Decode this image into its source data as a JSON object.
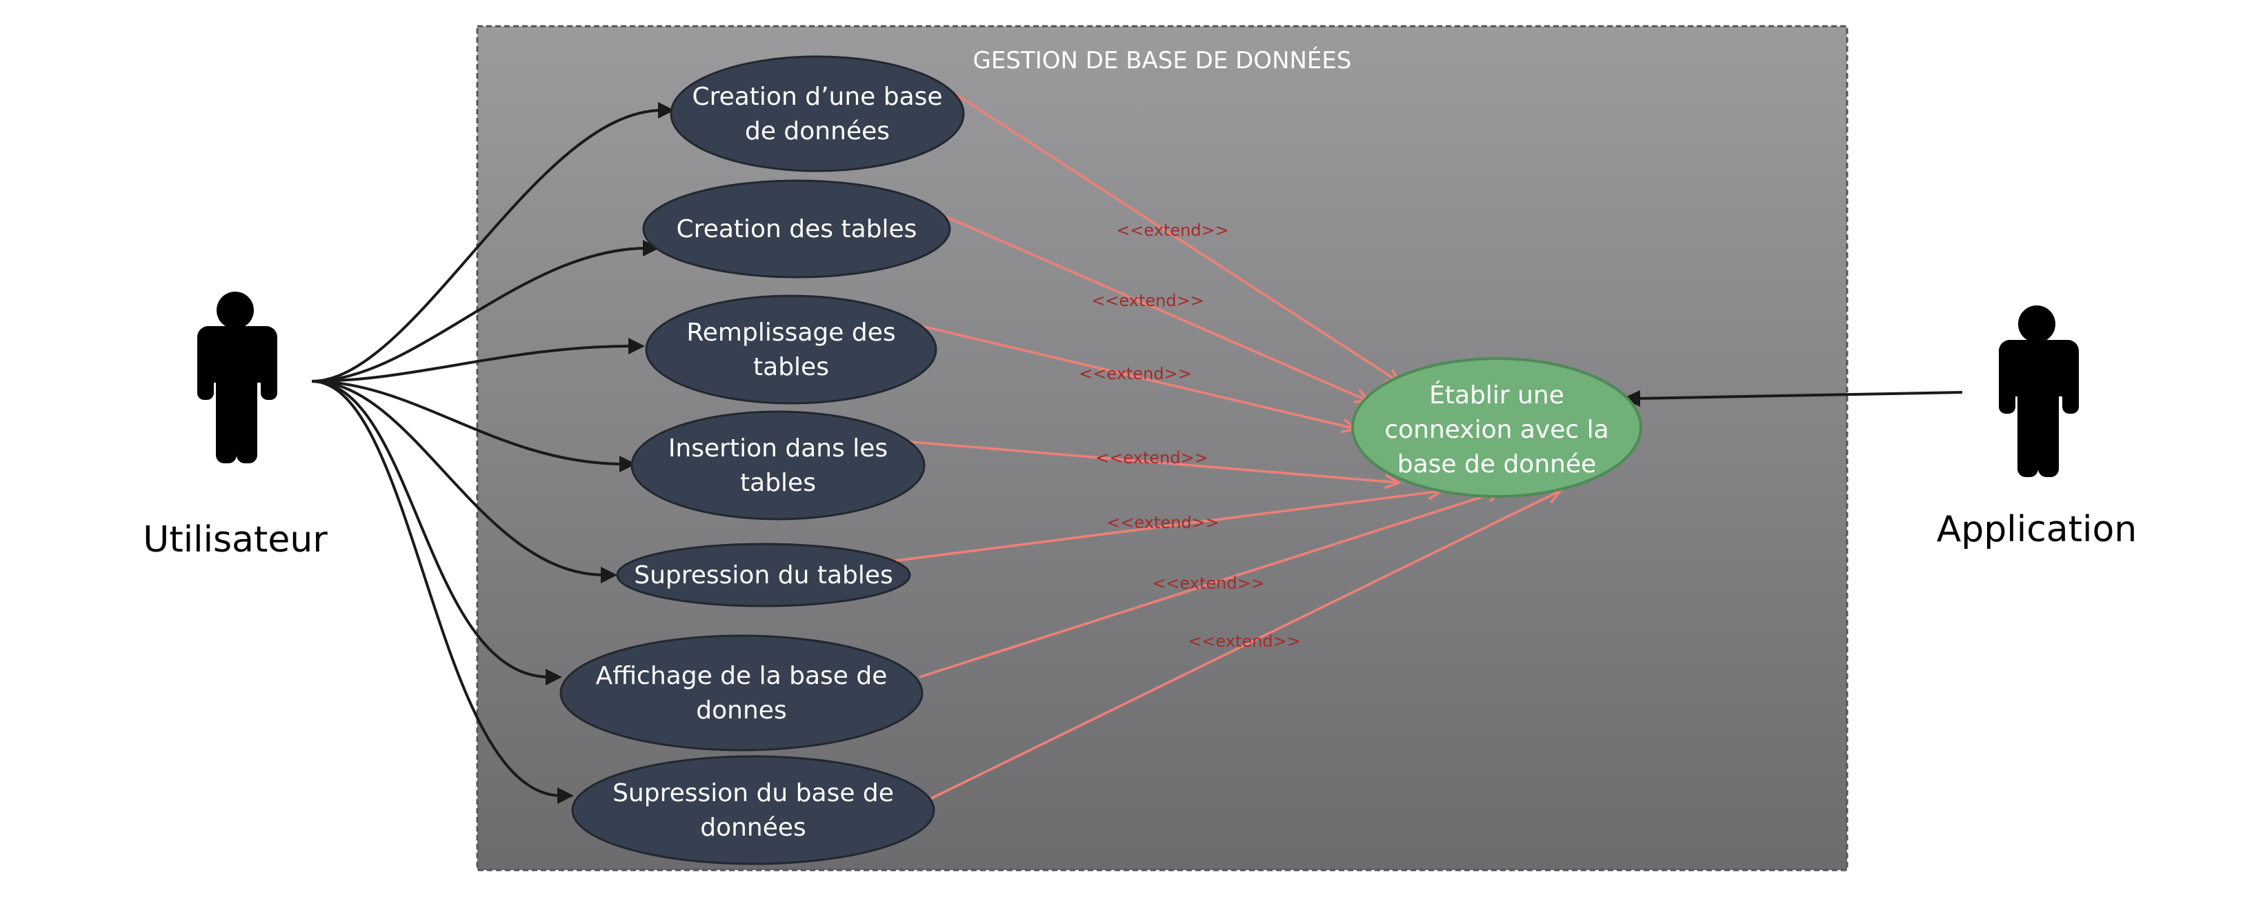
{
  "system": {
    "title": "GESTION DE BASE DE DONNÉES"
  },
  "actors": {
    "user": {
      "label": "Utilisateur",
      "icon": "stick-figure-icon"
    },
    "application": {
      "label": "Application",
      "icon": "stick-figure-icon"
    }
  },
  "use_cases": [
    {
      "id": "creation-base",
      "lines": [
        "Creation d’une base",
        "de données"
      ]
    },
    {
      "id": "creation-tables",
      "lines": [
        "Creation des tables"
      ]
    },
    {
      "id": "remplissage-tables",
      "lines": [
        "Remplissage des",
        "tables"
      ]
    },
    {
      "id": "insertion-tables",
      "lines": [
        "Insertion dans les",
        "tables"
      ]
    },
    {
      "id": "supression-tables",
      "lines": [
        "Supression du tables"
      ]
    },
    {
      "id": "affichage-base",
      "lines": [
        "Affichage de la base de",
        "donnes"
      ]
    },
    {
      "id": "supression-base",
      "lines": [
        "Supression du base de",
        "données"
      ]
    }
  ],
  "connection_use_case": {
    "lines": [
      "Établir une",
      "connexion avec la",
      "base de donnée"
    ]
  },
  "extend_label": "<<extend>>",
  "colors": {
    "use_case_fill": "#374050",
    "connection_fill": "#72b07a",
    "connection_stroke": "#4e8a57",
    "extend_line": "#f08078",
    "extend_text": "#a52a2a",
    "association_line": "#1a1a1a"
  }
}
